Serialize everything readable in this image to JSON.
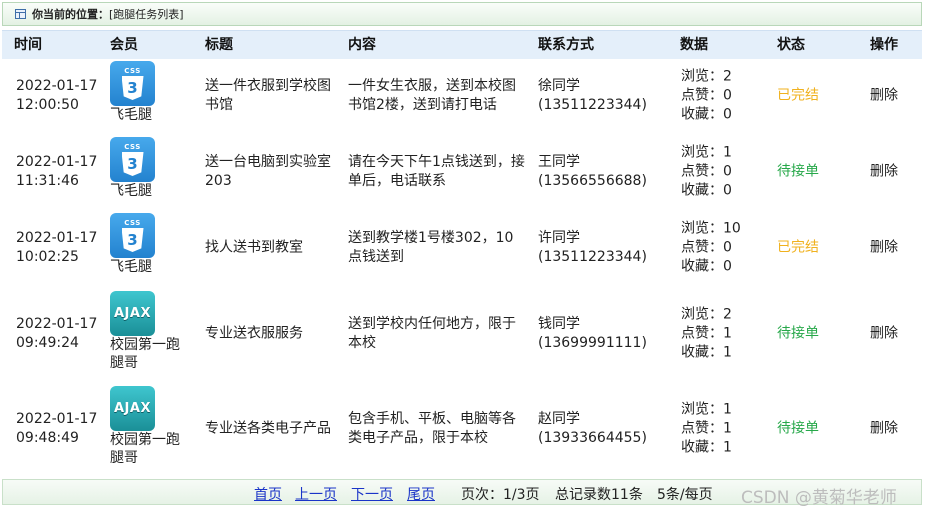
{
  "location": {
    "label": "你当前的位置：",
    "crumb": "[跑腿任务列表]"
  },
  "columns": [
    "时间",
    "会员",
    "标题",
    "内容",
    "联系方式",
    "数据",
    "状态",
    "操作"
  ],
  "rows": [
    {
      "date": "2022-01-17",
      "time": "12:00:50",
      "avatar": "css3-icon",
      "avatar_text": "CSS",
      "avatar_glyph": "3",
      "member": "飞毛腿",
      "title": "送一件衣服到学校图书馆",
      "content": "一件女生衣服，送到本校图书馆2楼，送到请打电话",
      "contact_name": "徐同学",
      "contact_phone": "(13511223344)",
      "views": "浏览：2",
      "likes": "点赞：0",
      "favs": "收藏：0",
      "status": "已完结",
      "status_kind": "done",
      "action": "删除"
    },
    {
      "date": "2022-01-17",
      "time": "11:31:46",
      "avatar": "css3-icon",
      "avatar_text": "CSS",
      "avatar_glyph": "3",
      "member": "飞毛腿",
      "title": "送一台电脑到实验室203",
      "content": "请在今天下午1点钱送到，接单后，电话联系",
      "contact_name": "王同学",
      "contact_phone": "(13566556688)",
      "views": "浏览：1",
      "likes": "点赞：0",
      "favs": "收藏：0",
      "status": "待接单",
      "status_kind": "wait",
      "action": "删除"
    },
    {
      "date": "2022-01-17",
      "time": "10:02:25",
      "avatar": "css3-icon",
      "avatar_text": "CSS",
      "avatar_glyph": "3",
      "member": "飞毛腿",
      "title": "找人送书到教室",
      "content": "送到教学楼1号楼302，10点钱送到",
      "contact_name": "许同学",
      "contact_phone": "(13511223344)",
      "views": "浏览：10",
      "likes": "点赞：0",
      "favs": "收藏：0",
      "status": "已完结",
      "status_kind": "done",
      "action": "删除"
    },
    {
      "date": "2022-01-17",
      "time": "09:49:24",
      "avatar": "ajax-icon",
      "avatar_text": "AJAX",
      "avatar_glyph": "",
      "member": "校园第一跑腿哥",
      "title": "专业送衣服服务",
      "content": "送到学校内任何地方，限于本校",
      "contact_name": "钱同学",
      "contact_phone": "(13699991111)",
      "views": "浏览：2",
      "likes": "点赞：1",
      "favs": "收藏：1",
      "status": "待接单",
      "status_kind": "wait",
      "action": "删除"
    },
    {
      "date": "2022-01-17",
      "time": "09:48:49",
      "avatar": "ajax-icon",
      "avatar_text": "AJAX",
      "avatar_glyph": "",
      "member": "校园第一跑腿哥",
      "title": "专业送各类电子产品",
      "content": "包含手机、平板、电脑等各类电子产品，限于本校",
      "contact_name": "赵同学",
      "contact_phone": "(13933664455)",
      "views": "浏览：1",
      "likes": "点赞：1",
      "favs": "收藏：1",
      "status": "待接单",
      "status_kind": "wait",
      "action": "删除"
    }
  ],
  "pagination": {
    "first": "首页",
    "prev": "上一页",
    "next": "下一页",
    "last": "尾页",
    "page_info": "页次：1/3页",
    "total_info": "总记录数11条",
    "per_page": "5条/每页"
  },
  "watermark": "CSDN @黄菊华老师",
  "colors": {
    "done": "#f0b11e",
    "wait": "#27a84a",
    "header_bg": "#e4effa",
    "link": "#1a34c8"
  }
}
